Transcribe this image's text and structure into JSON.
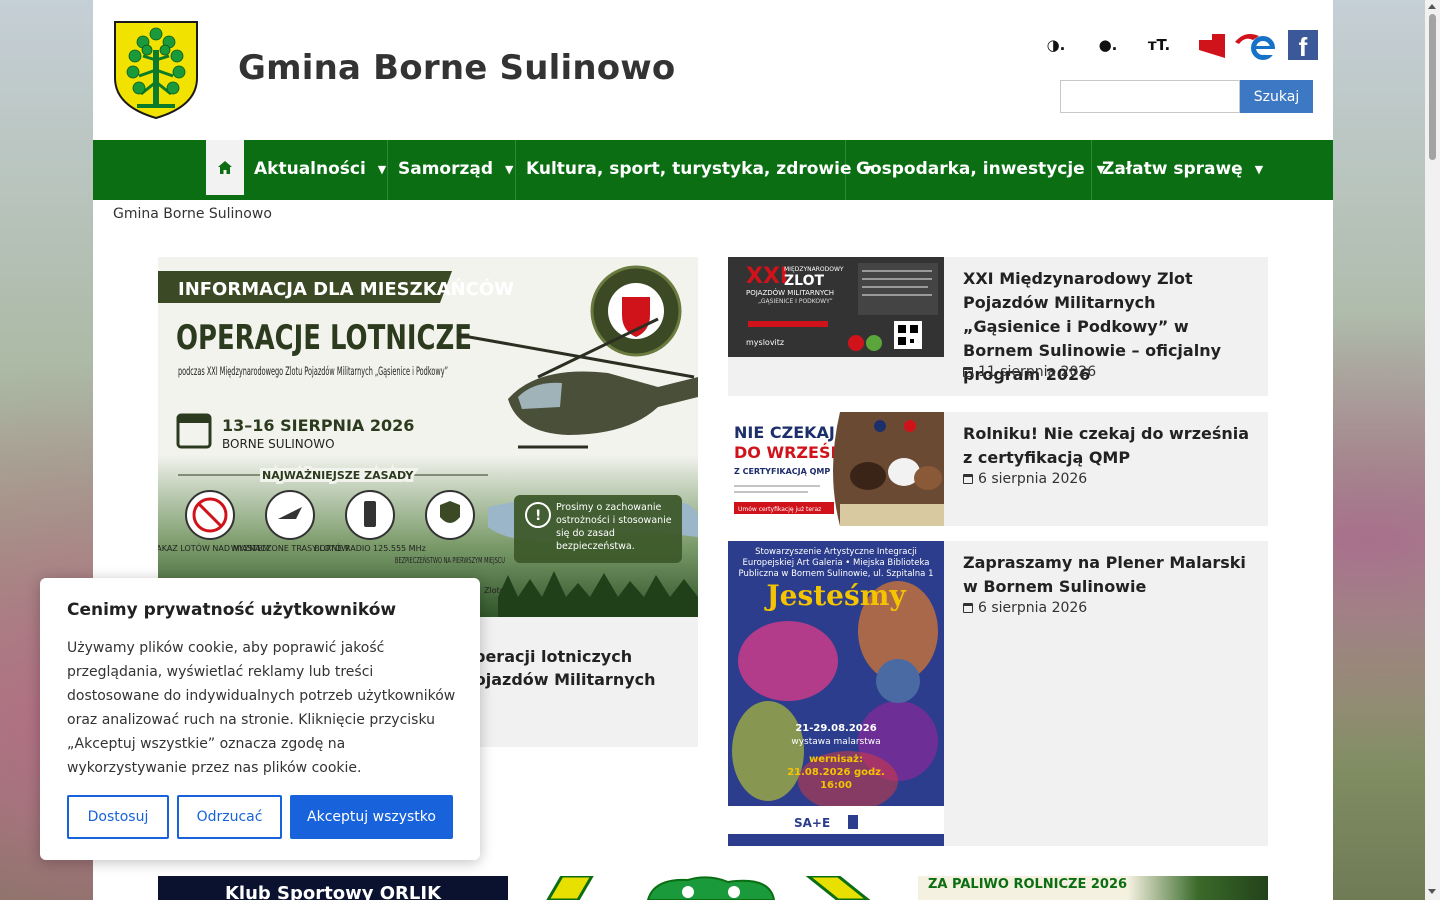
{
  "header": {
    "site_title": "Gmina Borne Sulinowo",
    "accessibility": {
      "contrast_label": "◑.",
      "ink_label": "●.",
      "font_size_label": "тT."
    },
    "bip_label": "bip",
    "facebook_label": "f",
    "search": {
      "placeholder": "",
      "button_label": "Szukaj"
    }
  },
  "nav": {
    "items": [
      {
        "label": "Aktualności"
      },
      {
        "label": "Samorząd"
      },
      {
        "label": "Kultura, sport, turystyka, zdrowie"
      },
      {
        "label": "Gospodarka, inwestycje"
      },
      {
        "label": "Załatw sprawę"
      }
    ]
  },
  "breadcrumb": "Gmina Borne Sulinowo",
  "feature": {
    "image": {
      "banner_label": "INFORMACJA DLA MIESZKAŃCÓW",
      "headline": "OPERACJE LOTNICZE",
      "subline": "podczas XXI Międzynarodowego Zlotu Pojazdów Militarnych „Gąsienice i Podkowy”",
      "dates": "13–16 SIERPNIA 2026",
      "place": "BORNE SULINOWO",
      "rules_title": "NAJWAŻNIEJSZE ZASADY",
      "rules": [
        "ZAKAZ LOTÓW NAD MIASTEM",
        "WYZNACZONE TRASY LOTÓW",
        "BORNE RADIO 125.555 MHz",
        "BEZPIECZEŃSTWO NA PIERWSZYM MIEJSCU"
      ],
      "notice": "Prosimy o zachowanie ostrożności i stosowanie się do zasad bezpieczeństwa.",
      "footer_fragment": "Zlotem."
    },
    "title_visible": "operacji lotniczych Pojazdów Militarnych"
  },
  "news": [
    {
      "title": "XXI Międzynarodowy Zlot Pojazdów Militarnych „Gąsienice i Podkowy” w Bornem Sulinowie – oficjalny program 2026",
      "date": "11 sierpnia 2026",
      "thumb": {
        "big": "XXI",
        "line1": "MIĘDZYNARODOWY",
        "line2": "ZLOT",
        "line3": "POJAZDÓW MILITARNYCH",
        "line4": "„GĄSIENICE I PODKOWY”",
        "brand": "myslovitz"
      }
    },
    {
      "title": "Rolniku! Nie czekaj do września z certyfikacją QMP",
      "date": "6 sierpnia 2026",
      "thumb": {
        "line1": "NIE CZEKAJ",
        "line2": "DO WRZEŚNIA",
        "line3": "Z CERTYFIKACJĄ QMP",
        "cta": "Umów certyfikację już teraz"
      }
    },
    {
      "title": "Zapraszamy na Plener Malarski w Bornem Sulinowie",
      "date": "6 sierpnia 2026",
      "thumb": {
        "top": "Stowarzyszenie Artystyczne Integracji Europejskiej Art Galeria • Miejska Biblioteka Publiczna w Bornem Sulinowie, ul. Szpitalna 1",
        "word": "Jesteśmy",
        "dates": "21-29.08.2026",
        "subtitle": "wystawa malarstwa",
        "vernissage": "wernisaż: 21.08.2026 godz. 16:00"
      }
    }
  ],
  "banners": {
    "left": "Klub Sportowy ORLIK",
    "right": "ZA PALIWO ROLNICZE 2026"
  },
  "cookie": {
    "title": "Cenimy prywatność użytkowników",
    "text": "Używamy plików cookie, aby poprawić jakość przeglądania, wyświetlać reklamy lub treści dostosowane do indywidualnych potrzeb użytkowników oraz analizować ruch na stronie. Kliknięcie przycisku „Akceptuj wszystkie” oznacza zgodę na wykorzystywanie przez nas plików cookie.",
    "customize": "Dostosuj",
    "reject": "Odrzucać",
    "accept": "Akceptuj wszystko"
  },
  "colors": {
    "nav_green": "#0b6e13",
    "search_blue": "#3c78c3",
    "cookie_blue": "#1863dc"
  }
}
